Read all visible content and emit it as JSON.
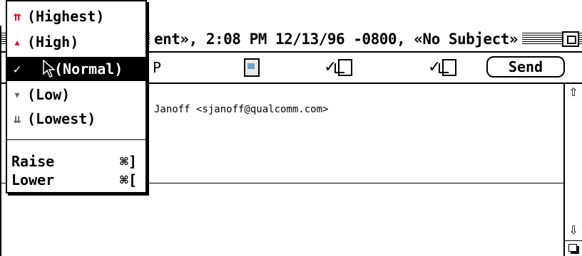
{
  "window": {
    "title": "ent», 2:08 PM 12/13/96 -0800, «No Subject»"
  },
  "toolbar": {
    "partial_label": "P",
    "send_label": "Send"
  },
  "header": {
    "to_value": "Janoff <sjanoff@qualcomm.com>"
  },
  "priority_menu": {
    "items": [
      {
        "label": "(Highest)",
        "icon": "double-up-arrow-icon",
        "glyph": "⌃",
        "checked": false
      },
      {
        "label": "(High)",
        "icon": "up-arrow-icon",
        "glyph": "˄",
        "checked": false
      },
      {
        "label": "(Normal)",
        "icon": "none",
        "glyph": "",
        "checked": true
      },
      {
        "label": "(Low)",
        "icon": "down-arrow-icon",
        "glyph": "˅",
        "checked": false
      },
      {
        "label": "(Lowest)",
        "icon": "double-down-arrow-icon",
        "glyph": "⌄",
        "checked": false
      }
    ],
    "check_mark": "✓",
    "raise_label": "Raise",
    "raise_shortcut": "⌘]",
    "lower_label": "Lower",
    "lower_shortcut": "⌘["
  },
  "colors": {
    "priority_high": "#e8002a",
    "priority_low": "#666666",
    "selection": "#000000"
  }
}
